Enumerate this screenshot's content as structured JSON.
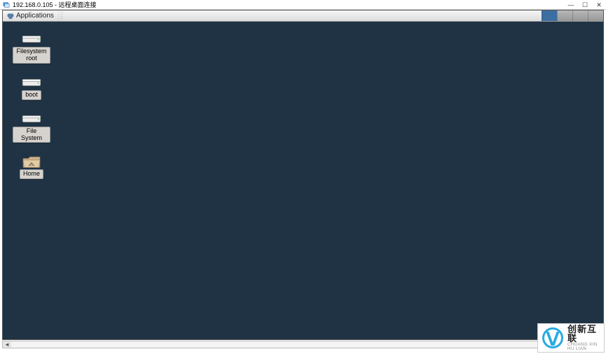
{
  "window": {
    "title": "192.168.0.105 - 远程桌面连接"
  },
  "win_controls": {
    "minimize": "—",
    "maximize": "☐",
    "close": "✕"
  },
  "panel": {
    "applications_label": "Applications"
  },
  "desktop_icons": [
    {
      "name": "filesystem-root",
      "label": "Filesystem\nroot",
      "type": "drive"
    },
    {
      "name": "boot",
      "label": "boot",
      "type": "drive"
    },
    {
      "name": "file-system",
      "label": "File System",
      "type": "drive"
    },
    {
      "name": "home",
      "label": "Home",
      "type": "folder-home"
    }
  ],
  "watermark": {
    "cn": "创新互联",
    "en": "CHUANG XIN HU LIAN"
  }
}
